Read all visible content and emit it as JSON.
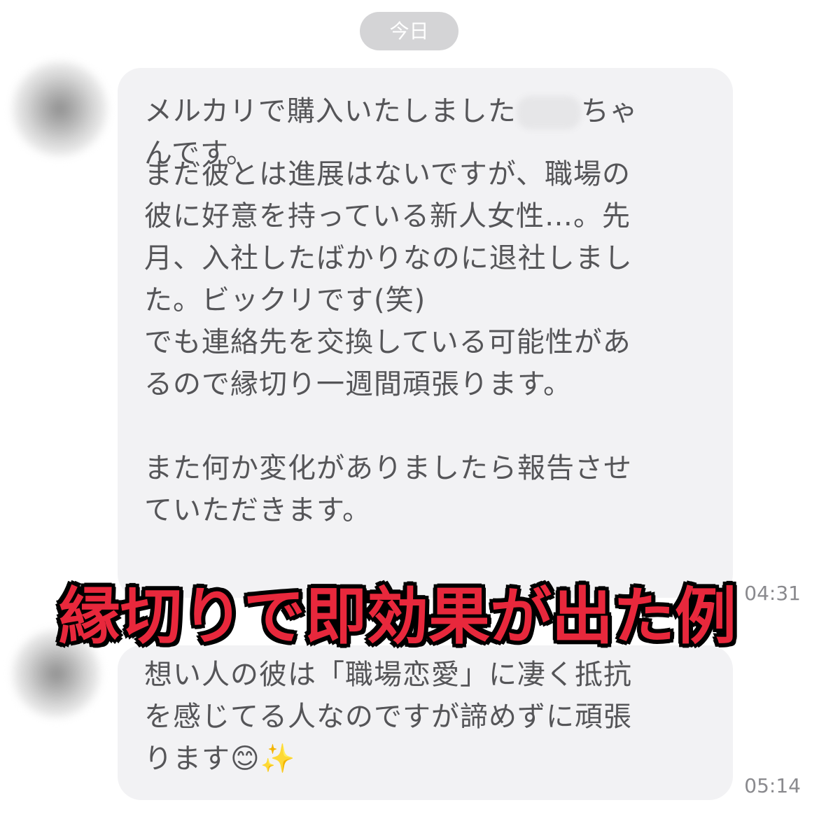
{
  "date_label": "今日",
  "message1": {
    "line1_before": "メルカリで購入いたしました",
    "line1_after": "ちゃ",
    "line2": "んです。",
    "para2": [
      "まだ彼とは進展はないですが、職場の",
      "彼に好意を持っている新人女性…。先",
      "月、入社したばかりなのに退社しまし",
      "た。ビックリです(笑)",
      "でも連絡先を交換している可能性があ",
      "るので縁切り一週間頑張ります。"
    ],
    "para3": [
      "また何か変化がありましたら報告させ",
      "ていただきます。"
    ],
    "time": "04:31"
  },
  "message2": {
    "lines": [
      "想い人の彼は「職場恋愛」に凄く抵抗",
      "を感じてる人なのですが諦めずに頑張"
    ],
    "last_line_text": "ります",
    "emoji1": "😊",
    "emoji2": "✨",
    "time": "05:14"
  },
  "overlay_caption": "縁切りで即効果が出た例"
}
